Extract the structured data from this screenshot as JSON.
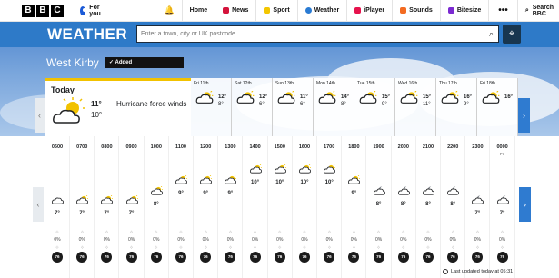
{
  "topbar": {
    "logo": [
      "B",
      "B",
      "C"
    ],
    "for_you": "For you",
    "nav": [
      {
        "label": "Home",
        "color": ""
      },
      {
        "label": "News",
        "color": "#d4133b"
      },
      {
        "label": "Sport",
        "color": "#f3c600"
      },
      {
        "label": "Weather",
        "color": "#2a7bd3"
      },
      {
        "label": "iPlayer",
        "color": "#e6134d"
      },
      {
        "label": "Sounds",
        "color": "#f36b21"
      },
      {
        "label": "Bitesize",
        "color": "#7b2ad1"
      }
    ],
    "more": "•••",
    "search_label": "Search BBC"
  },
  "weather_header": {
    "title": "WEATHER",
    "search_placeholder": "Enter a town, city or UK postcode"
  },
  "location": {
    "name": "West Kirby",
    "added_label": "Added"
  },
  "today": {
    "label": "Today",
    "high": "11°",
    "low": "10°",
    "description": "Hurricane force winds"
  },
  "days": [
    {
      "label": "Fri 11th",
      "high": "12°",
      "low": "8°"
    },
    {
      "label": "Sat 12th",
      "high": "12°",
      "low": "6°"
    },
    {
      "label": "Sun 13th",
      "high": "11°",
      "low": "6°"
    },
    {
      "label": "Mon 14th",
      "high": "14°",
      "low": "8°"
    },
    {
      "label": "Tue 15th",
      "high": "15°",
      "low": "9°"
    },
    {
      "label": "Wed 16th",
      "high": "15°",
      "low": "11°"
    },
    {
      "label": "Thu 17th",
      "high": "16°",
      "low": "9°"
    },
    {
      "label": "Fri 18th",
      "high": "16°",
      "low": ""
    }
  ],
  "hourly": [
    {
      "time": "0600",
      "temp": "7°",
      "rain": "0%",
      "wind": "76",
      "pos": "low",
      "icon": "cloud"
    },
    {
      "time": "0700",
      "temp": "7°",
      "rain": "0%",
      "wind": "76",
      "pos": "low",
      "icon": "sun-cloud"
    },
    {
      "time": "0800",
      "temp": "7°",
      "rain": "0%",
      "wind": "76",
      "pos": "low",
      "icon": "sun-cloud"
    },
    {
      "time": "0900",
      "temp": "7°",
      "rain": "0%",
      "wind": "76",
      "pos": "low",
      "icon": "sun-cloud"
    },
    {
      "time": "1000",
      "temp": "8°",
      "rain": "0%",
      "wind": "76",
      "pos": "mid2",
      "icon": "sun-cloud"
    },
    {
      "time": "1100",
      "temp": "9°",
      "rain": "0%",
      "wind": "76",
      "pos": "mid",
      "icon": "sun-cloud"
    },
    {
      "time": "1200",
      "temp": "9°",
      "rain": "0%",
      "wind": "76",
      "pos": "mid",
      "icon": "sun-cloud"
    },
    {
      "time": "1300",
      "temp": "9°",
      "rain": "0%",
      "wind": "76",
      "pos": "mid",
      "icon": "sun-cloud"
    },
    {
      "time": "1400",
      "temp": "10°",
      "rain": "0%",
      "wind": "76",
      "pos": "high",
      "icon": "sun-cloud"
    },
    {
      "time": "1500",
      "temp": "10°",
      "rain": "0%",
      "wind": "76",
      "pos": "high",
      "icon": "sun-cloud"
    },
    {
      "time": "1600",
      "temp": "10°",
      "rain": "0%",
      "wind": "76",
      "pos": "high",
      "icon": "sun-cloud"
    },
    {
      "time": "1700",
      "temp": "10°",
      "rain": "0%",
      "wind": "76",
      "pos": "high",
      "icon": "sun-cloud"
    },
    {
      "time": "1800",
      "temp": "9°",
      "rain": "0%",
      "wind": "76",
      "pos": "mid",
      "icon": "sun-cloud"
    },
    {
      "time": "1900",
      "temp": "8°",
      "rain": "0%",
      "wind": "76",
      "pos": "mid2",
      "icon": "moon-cloud"
    },
    {
      "time": "2000",
      "temp": "8°",
      "rain": "0%",
      "wind": "76",
      "pos": "mid2",
      "icon": "moon-cloud"
    },
    {
      "time": "2100",
      "temp": "8°",
      "rain": "0%",
      "wind": "76",
      "pos": "mid2",
      "icon": "moon-cloud"
    },
    {
      "time": "2200",
      "temp": "8°",
      "rain": "0%",
      "wind": "76",
      "pos": "mid2",
      "icon": "moon-cloud"
    },
    {
      "time": "2300",
      "temp": "7°",
      "rain": "0%",
      "wind": "76",
      "pos": "low",
      "icon": "moon-cloud"
    },
    {
      "time": "0000",
      "sub": "Fri",
      "temp": "7°",
      "rain": "0%",
      "wind": "76",
      "pos": "low",
      "icon": "moon-cloud"
    }
  ],
  "footer": {
    "updated": "Last updated today at 05:31"
  }
}
